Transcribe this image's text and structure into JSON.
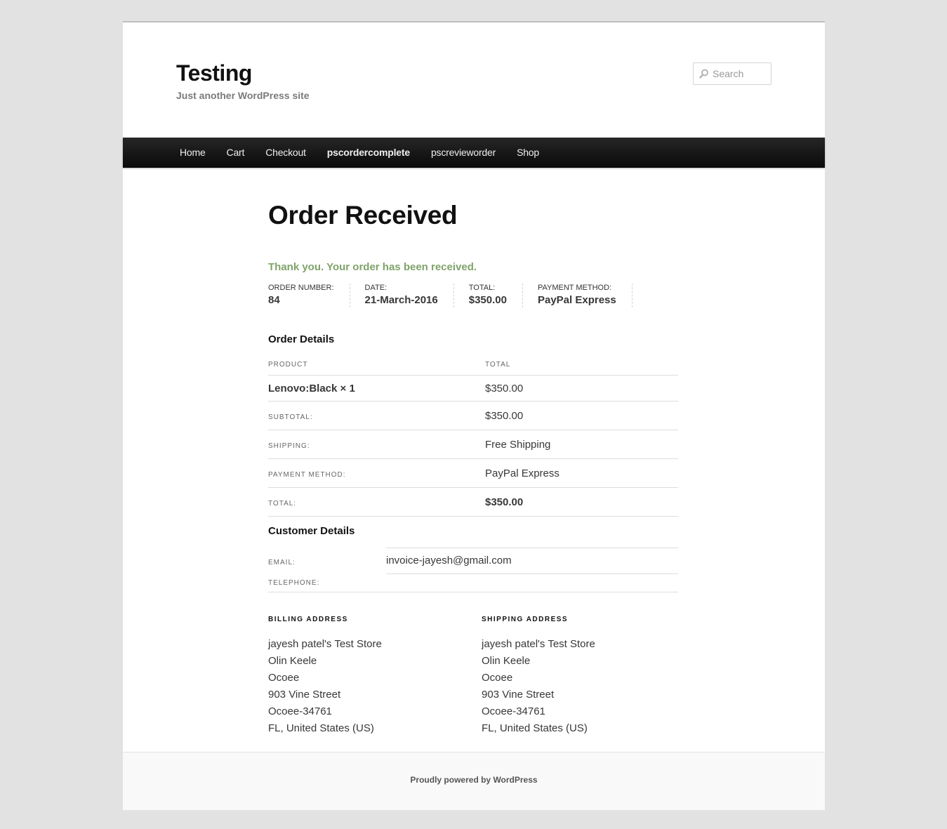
{
  "site": {
    "title": "Testing",
    "description": "Just another WordPress site"
  },
  "search": {
    "placeholder": "Search",
    "icon": "magnifier-icon"
  },
  "nav": {
    "items": [
      {
        "label": "Home"
      },
      {
        "label": "Cart"
      },
      {
        "label": "Checkout"
      },
      {
        "label": "pscordercomplete",
        "current": true
      },
      {
        "label": "pscrevieworder"
      },
      {
        "label": "Shop"
      }
    ]
  },
  "page": {
    "title": "Order Received",
    "thanks": "Thank you. Your order has been received."
  },
  "overview": {
    "order_number_label": "Order Number:",
    "order_number": "84",
    "date_label": "Date:",
    "date": "21-March-2016",
    "total_label": "Total:",
    "total": "$350.00",
    "payment_method_label": "Payment Method:",
    "payment_method": "PayPal Express"
  },
  "order_details": {
    "heading": "Order Details",
    "col_product": "PRODUCT",
    "col_total": "TOTAL",
    "item": {
      "product": "Lenovo:Black × 1",
      "total": "$350.00"
    },
    "subtotal_label": "SUBTOTAL:",
    "subtotal": "$350.00",
    "shipping_label": "SHIPPING:",
    "shipping": "Free Shipping",
    "payment_label": "PAYMENT METHOD:",
    "payment": "PayPal Express",
    "total_label": "TOTAL:",
    "total": "$350.00"
  },
  "customer_details": {
    "heading": "Customer Details",
    "email_label": "EMAIL:",
    "email": "invoice-jayesh@gmail.com",
    "telephone_label": "TELEPHONE:",
    "telephone": ""
  },
  "billing": {
    "heading": "BILLING ADDRESS",
    "lines": [
      "jayesh patel's Test Store",
      "Olin Keele",
      "Ocoee",
      "903 Vine Street",
      "Ocoee-34761",
      "FL, United States (US)"
    ]
  },
  "shipping": {
    "heading": "SHIPPING ADDRESS",
    "lines": [
      "jayesh patel's Test Store",
      "Olin Keele",
      "Ocoee",
      "903 Vine Street",
      "Ocoee-34761",
      "FL, United States (US)"
    ]
  },
  "footer": {
    "text": "Proudly powered by WordPress"
  },
  "colors": {
    "background": "#e2e2e2",
    "nav": "#0a0a0a",
    "thanks": "#7fa36a",
    "text": "#373737"
  }
}
